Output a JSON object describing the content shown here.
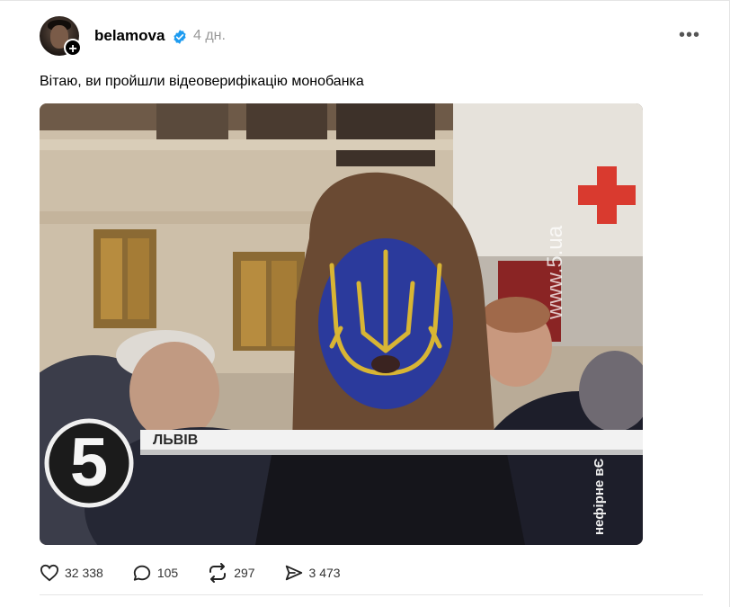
{
  "post": {
    "username": "belamova",
    "time": "4 дн.",
    "text": "Вітаю, ви пройшли відеоверифікацію монобанка",
    "more_label": "•••",
    "follow_symbol": "+"
  },
  "media": {
    "channel_logo": "5",
    "location_caption": "ЛЬВІВ",
    "watermark": "www.5.ua",
    "side_caption": "нефірне вЄ"
  },
  "actions": {
    "likes": "32 338",
    "comments": "105",
    "reposts": "297",
    "shares": "3 473"
  },
  "colors": {
    "verified": "#1d9bf0",
    "face_blue": "#2b3a9c",
    "trident_yellow": "#d8b534"
  }
}
